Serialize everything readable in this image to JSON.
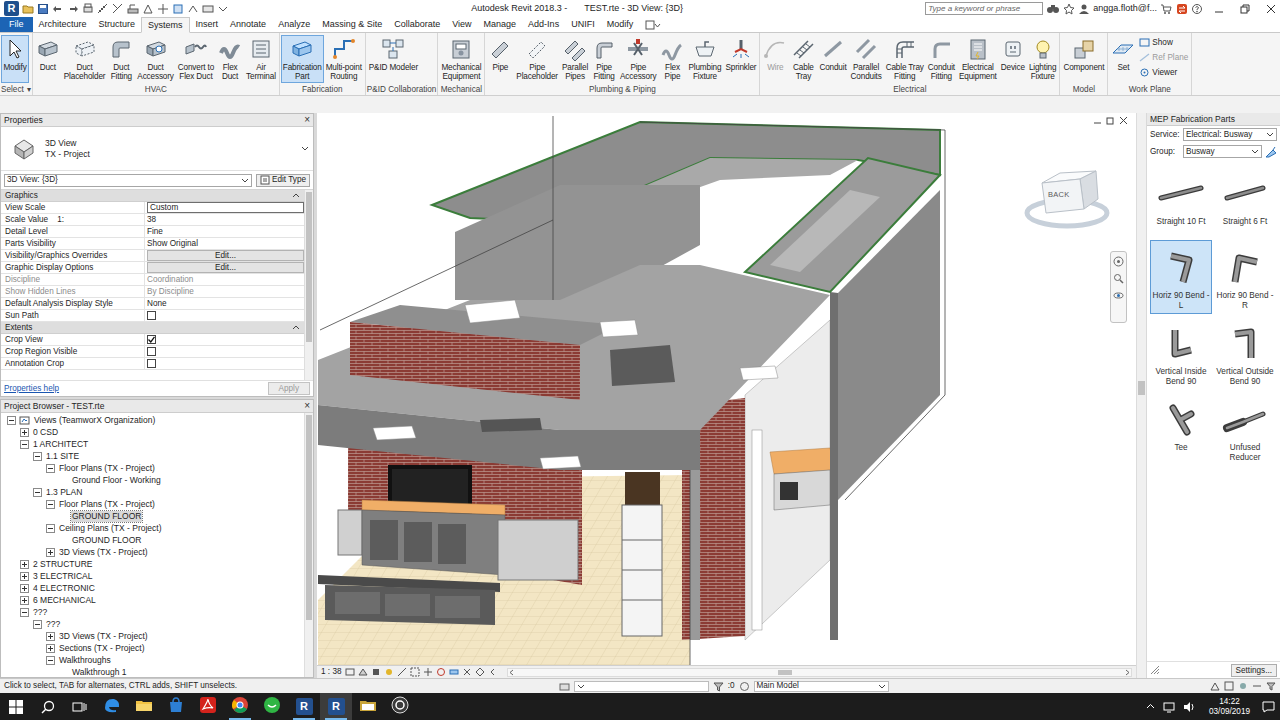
{
  "window": {
    "logo": "R",
    "app": "Autodesk Revit 2018.3 -",
    "document": "TEST.rte - 3D View: {3D}",
    "search_placeholder": "Type a keyword or phrase",
    "user": "angga.floth@f..."
  },
  "tabs": [
    {
      "label": "File",
      "kind": "file",
      "selected": false
    },
    {
      "label": "Architecture",
      "kind": "tab",
      "selected": false
    },
    {
      "label": "Structure",
      "kind": "tab",
      "selected": false
    },
    {
      "label": "Systems",
      "kind": "tab",
      "selected": true
    },
    {
      "label": "Insert",
      "kind": "tab",
      "selected": false
    },
    {
      "label": "Annotate",
      "kind": "tab",
      "selected": false
    },
    {
      "label": "Analyze",
      "kind": "tab",
      "selected": false
    },
    {
      "label": "Massing & Site",
      "kind": "tab",
      "selected": false
    },
    {
      "label": "Collaborate",
      "kind": "tab",
      "selected": false
    },
    {
      "label": "View",
      "kind": "tab",
      "selected": false
    },
    {
      "label": "Manage",
      "kind": "tab",
      "selected": false
    },
    {
      "label": "Add-Ins",
      "kind": "tab",
      "selected": false
    },
    {
      "label": "UNIFI",
      "kind": "tab",
      "selected": false
    },
    {
      "label": "Modify",
      "kind": "tab",
      "selected": false
    }
  ],
  "ribbon": [
    {
      "label": "Select",
      "dropdown": "▾",
      "buttons": [
        {
          "lines": [
            "Modify"
          ],
          "selected": true,
          "disabled": false
        }
      ]
    },
    {
      "label": "HVAC",
      "buttons": [
        {
          "lines": [
            "Duct"
          ],
          "selected": false,
          "disabled": false
        },
        {
          "lines": [
            "Duct",
            "Placeholder"
          ],
          "selected": false,
          "disabled": false
        },
        {
          "lines": [
            "Duct",
            "Fitting"
          ],
          "selected": false,
          "disabled": false
        },
        {
          "lines": [
            "Duct",
            "Accessory"
          ],
          "selected": false,
          "disabled": false
        },
        {
          "lines": [
            "Convert to",
            "Flex Duct"
          ],
          "selected": false,
          "disabled": false
        },
        {
          "lines": [
            "Flex",
            "Duct"
          ],
          "selected": false,
          "disabled": false
        },
        {
          "lines": [
            "Air",
            "Terminal"
          ],
          "selected": false,
          "disabled": false
        }
      ]
    },
    {
      "label": "Fabrication",
      "buttons": [
        {
          "lines": [
            "Fabrication",
            "Part"
          ],
          "selected": true,
          "disabled": false
        },
        {
          "lines": [
            "Multi-point",
            "Routing"
          ],
          "selected": false,
          "disabled": false
        }
      ]
    },
    {
      "label": "P&ID Collaboration",
      "buttons": [
        {
          "lines": [
            "P&ID Modeler"
          ],
          "selected": false,
          "disabled": false
        }
      ]
    },
    {
      "label": "Mechanical",
      "buttons": [
        {
          "lines": [
            "Mechanical",
            "Equipment"
          ],
          "selected": false,
          "disabled": false
        }
      ]
    },
    {
      "label": "Plumbing & Piping",
      "buttons": [
        {
          "lines": [
            "Pipe"
          ],
          "selected": false,
          "disabled": false
        },
        {
          "lines": [
            "Pipe",
            "Placeholder"
          ],
          "selected": false,
          "disabled": false
        },
        {
          "lines": [
            "Parallel",
            "Pipes"
          ],
          "selected": false,
          "disabled": false
        },
        {
          "lines": [
            "Pipe",
            "Fitting"
          ],
          "selected": false,
          "disabled": false
        },
        {
          "lines": [
            "Pipe",
            "Accessory"
          ],
          "selected": false,
          "disabled": false
        },
        {
          "lines": [
            "Flex",
            "Pipe"
          ],
          "selected": false,
          "disabled": false
        },
        {
          "lines": [
            "Plumbing",
            "Fixture"
          ],
          "selected": false,
          "disabled": false
        },
        {
          "lines": [
            "Sprinkler"
          ],
          "selected": false,
          "disabled": false
        }
      ]
    },
    {
      "label": "Electrical",
      "buttons": [
        {
          "lines": [
            "Wire"
          ],
          "selected": false,
          "disabled": true
        },
        {
          "lines": [
            "Cable",
            "Tray"
          ],
          "selected": false,
          "disabled": false
        },
        {
          "lines": [
            "Conduit"
          ],
          "selected": false,
          "disabled": false
        },
        {
          "lines": [
            "Parallel",
            "Conduits"
          ],
          "selected": false,
          "disabled": false
        },
        {
          "lines": [
            "Cable Tray",
            "Fitting"
          ],
          "selected": false,
          "disabled": false
        },
        {
          "lines": [
            "Conduit",
            "Fitting"
          ],
          "selected": false,
          "disabled": false
        },
        {
          "lines": [
            "Electrical",
            "Equipment"
          ],
          "selected": false,
          "disabled": false
        },
        {
          "lines": [
            "Device"
          ],
          "selected": false,
          "disabled": false
        },
        {
          "lines": [
            "Lighting",
            "Fixture"
          ],
          "selected": false,
          "disabled": false
        }
      ]
    },
    {
      "label": "Model",
      "buttons": [
        {
          "lines": [
            "Component"
          ],
          "selected": false,
          "disabled": false
        }
      ]
    },
    {
      "label": "Work Plane",
      "buttons": [
        {
          "lines": [
            "Set"
          ],
          "selected": false,
          "disabled": false
        }
      ],
      "small_buttons": [
        {
          "label": "Show",
          "disabled": false
        },
        {
          "label": "Ref Plane",
          "disabled": true
        },
        {
          "label": "Viewer",
          "disabled": false
        }
      ]
    }
  ],
  "properties": {
    "title": "Properties",
    "close": "×",
    "type_name": "3D View",
    "type_family": "TX - Project",
    "instance": "3D View: {3D}",
    "edit_type": "Edit Type",
    "sections": [
      {
        "label": "Graphics",
        "expanded": true,
        "rows": [
          {
            "name": "View Scale",
            "value": "Custom",
            "kind": "input",
            "disabled": false
          },
          {
            "name": "Scale Value    1:",
            "value": "38",
            "kind": "text",
            "disabled": false
          },
          {
            "name": "Detail Level",
            "value": "Fine",
            "kind": "text",
            "disabled": false
          },
          {
            "name": "Parts Visibility",
            "value": "Show Original",
            "kind": "text",
            "disabled": false
          },
          {
            "name": "Visibility/Graphics Overrides",
            "value": "Edit...",
            "kind": "button",
            "disabled": false
          },
          {
            "name": "Graphic Display Options",
            "value": "Edit...",
            "kind": "button",
            "disabled": false
          },
          {
            "name": "Discipline",
            "value": "Coordination",
            "kind": "text",
            "disabled": true
          },
          {
            "name": "Show Hidden Lines",
            "value": "By Discipline",
            "kind": "text",
            "disabled": true
          },
          {
            "name": "Default Analysis Display Style",
            "value": "None",
            "kind": "text",
            "disabled": false
          },
          {
            "name": "Sun Path",
            "kind": "checkbox",
            "checked": false,
            "disabled": false
          }
        ]
      },
      {
        "label": "Extents",
        "expanded": true,
        "rows": [
          {
            "name": "Crop View",
            "kind": "checkbox",
            "checked": true,
            "disabled": false
          },
          {
            "name": "Crop Region Visible",
            "kind": "checkbox",
            "checked": false,
            "disabled": false
          },
          {
            "name": "Annotation Crop",
            "kind": "checkbox",
            "checked": false,
            "disabled": false
          }
        ]
      }
    ],
    "help": "Properties help",
    "apply": {
      "label": "Apply",
      "disabled": true
    }
  },
  "browser": {
    "title": "Project Browser - TEST.rte",
    "close": "×",
    "items": [
      {
        "label": "Views (TeamworX Organization)",
        "depth": 0,
        "kind": "folder",
        "expanded": true,
        "selected": false
      },
      {
        "label": "0 CSD",
        "depth": 1,
        "kind": "folder",
        "expanded": false,
        "selected": false
      },
      {
        "label": "1 ARCHITECT",
        "depth": 1,
        "kind": "folder",
        "expanded": true,
        "selected": false
      },
      {
        "label": "1.1 SITE",
        "depth": 2,
        "kind": "folder",
        "expanded": true,
        "selected": false
      },
      {
        "label": "Floor Plans (TX - Project)",
        "depth": 3,
        "kind": "folder",
        "expanded": true,
        "selected": false
      },
      {
        "label": "Ground Floor - Working",
        "depth": 4,
        "kind": "leaf",
        "selected": false
      },
      {
        "label": "1.3 PLAN",
        "depth": 2,
        "kind": "folder",
        "expanded": true,
        "selected": false
      },
      {
        "label": "Floor Plans (TX - Project)",
        "depth": 3,
        "kind": "folder",
        "expanded": true,
        "selected": false
      },
      {
        "label": "GROUND FLOOR",
        "depth": 4,
        "kind": "leaf",
        "selected": true
      },
      {
        "label": "Ceiling Plans (TX - Project)",
        "depth": 3,
        "kind": "folder",
        "expanded": true,
        "selected": false
      },
      {
        "label": "GROUND FLOOR",
        "depth": 4,
        "kind": "leaf",
        "selected": false
      },
      {
        "label": "3D Views (TX - Project)",
        "depth": 3,
        "kind": "folder",
        "expanded": false,
        "selected": false
      },
      {
        "label": "2 STRUCTURE",
        "depth": 1,
        "kind": "folder",
        "expanded": false,
        "selected": false
      },
      {
        "label": "3 ELECTRICAL",
        "depth": 1,
        "kind": "folder",
        "expanded": false,
        "selected": false
      },
      {
        "label": "4 ELECTRONIC",
        "depth": 1,
        "kind": "folder",
        "expanded": false,
        "selected": false
      },
      {
        "label": "6 MECHANICAL",
        "depth": 1,
        "kind": "folder",
        "expanded": false,
        "selected": false
      },
      {
        "label": "???",
        "depth": 1,
        "kind": "folder",
        "expanded": true,
        "selected": false
      },
      {
        "label": "???",
        "depth": 2,
        "kind": "folder",
        "expanded": true,
        "selected": false
      },
      {
        "label": "3D Views (TX - Project)",
        "depth": 3,
        "kind": "folder",
        "expanded": false,
        "selected": false
      },
      {
        "label": "Sections (TX - Project)",
        "depth": 3,
        "kind": "folder",
        "expanded": false,
        "selected": false
      },
      {
        "label": "Walkthroughs",
        "depth": 3,
        "kind": "folder",
        "expanded": true,
        "selected": false
      },
      {
        "label": "Walkthrough 1",
        "depth": 4,
        "kind": "leaf",
        "selected": false
      }
    ]
  },
  "viewport": {
    "viewcube": "BACK",
    "scale": "1 : 38"
  },
  "fabrication": {
    "title": "MEP Fabrication Parts",
    "service_label": "Service:",
    "service": "Electrical: Busway",
    "group_label": "Group:",
    "group": "Busway",
    "parts": [
      {
        "label": "Straight 10 Ft",
        "selected": false
      },
      {
        "label": "Straight 6 Ft",
        "selected": false
      },
      {
        "label": "Horiz 90 Bend - L",
        "selected": true
      },
      {
        "label": "Horiz 90 Bend - R",
        "selected": false
      },
      {
        "label": "Vertical Inside Bend 90",
        "selected": false
      },
      {
        "label": "Vertical Outside Bend 90",
        "selected": false
      },
      {
        "label": "Tee",
        "selected": false
      },
      {
        "label": "Unfused Reducer",
        "selected": false
      }
    ],
    "settings": "Settings..."
  },
  "status_bar": {
    "message": "Click to select, TAB for alternates, CTRL adds, SHIFT unselects.",
    "count": ":0",
    "model": "Main Model"
  },
  "taskbar": {
    "time": "14:22",
    "date": "03/09/2019",
    "apps": [
      {
        "open": false,
        "active": false
      },
      {
        "open": false,
        "active": false
      },
      {
        "open": false,
        "active": false
      },
      {
        "open": false,
        "active": false
      },
      {
        "open": true,
        "active": false
      },
      {
        "open": false,
        "active": false
      },
      {
        "open": true,
        "active": false,
        "glyph": "R"
      },
      {
        "open": true,
        "active": true,
        "glyph": "R"
      },
      {
        "open": false,
        "active": false
      },
      {
        "open": false,
        "active": false
      }
    ]
  }
}
